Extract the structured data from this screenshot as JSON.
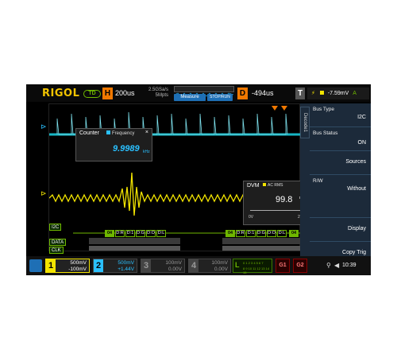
{
  "header": {
    "logo": "RIGOL",
    "mode": "TD",
    "h_letter": "H",
    "timebase": "200us",
    "sample_rate": "2.5GSa/s",
    "mem": "5Mpts",
    "measure": "Measure",
    "stop_run": "STOP/RUN",
    "d_letter": "D",
    "delay": "-494us",
    "t_letter": "T",
    "trigger_level": "-7.59mV",
    "trigger_source": "A"
  },
  "counter": {
    "title": "Counter",
    "type": "Frequency",
    "value": "9.9989",
    "unit": "kHz",
    "close": "×"
  },
  "dvm": {
    "title": "DVM",
    "type": "AC RMS",
    "value": "99.8",
    "unit": "mV",
    "min": "0V",
    "max": "2V",
    "close": "×"
  },
  "decode": {
    "bus_label": "I2C",
    "data_label": "DATA",
    "clk_label": "CLK",
    "packets_a": [
      "04",
      "D:R",
      "D:1",
      "D:G",
      "D:O",
      "D:L"
    ],
    "packets_b": [
      "04",
      "D:R",
      "D:1",
      "D:G",
      "D:O",
      "D:L",
      "04"
    ]
  },
  "side_panel": {
    "tab": "Decode1",
    "items": [
      {
        "label": "Bus Type",
        "value": "I2C"
      },
      {
        "label": "Bus Status",
        "value": "ON"
      },
      {
        "label": "",
        "value": "Sources"
      },
      {
        "label": "R/W",
        "value": "Without"
      },
      {
        "label": "",
        "value": "Display"
      },
      {
        "label": "",
        "value": "Copy Trig"
      }
    ]
  },
  "channels": [
    {
      "num": "1",
      "line1": "500mV",
      "line2": "-100mV",
      "color": "#f2e400"
    },
    {
      "num": "2",
      "line1": "500mV",
      "line2": "+1.44V",
      "color": "#2ac0ff"
    },
    {
      "num": "3",
      "line1": "100mV",
      "line2": "0.00V",
      "color": "#666666"
    },
    {
      "num": "4",
      "line1": "100mV",
      "line2": "0.00V",
      "color": "#666666"
    }
  ],
  "logic": {
    "letter": "L",
    "row1": "0 1 2 3 4 5 6 7",
    "row2": "8 9 10 11 12 13 14 15"
  },
  "gen": {
    "g1": "G1",
    "g2": "G2"
  },
  "status": {
    "time": "10:39"
  }
}
